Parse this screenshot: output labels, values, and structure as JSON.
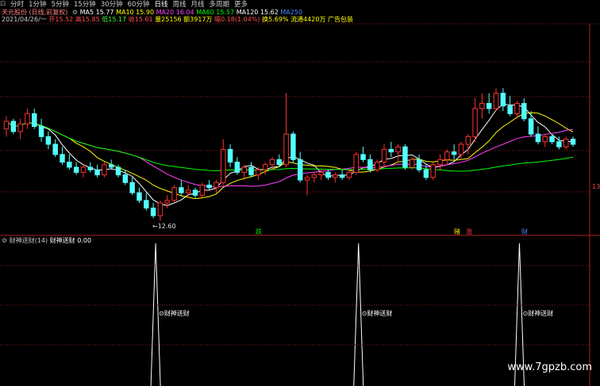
{
  "toolbar": {
    "items": [
      "分时",
      "1分钟",
      "5分钟",
      "15分钟",
      "30分钟",
      "60分钟",
      "日线",
      "周线",
      "月线",
      "多周期",
      "更多"
    ],
    "selected_index": 6,
    "leading_icon": "chart-frame-icon"
  },
  "info1": {
    "stock": "天元股份 (日线,前复权)",
    "ma5_label": "MA5",
    "ma5_value": "15.77",
    "ma10_label": "MA10",
    "ma10_value": "15.90",
    "ma20_label": "MA20",
    "ma20_value": "16.04",
    "ma60_label": "MA60",
    "ma60_value": "15.57",
    "ma120_label": "MA120",
    "ma120_value": "15.62",
    "ma250_label": "MA250",
    "value_color_ma5": "#ffffff",
    "value_color_ma10": "#ffff00",
    "value_color_ma20": "#ff44ff",
    "value_color_ma60": "#00ff00",
    "value_color_ma120": "#ffffff",
    "value_color_ma250": "#4488ff"
  },
  "info2": {
    "date": "2021/04/26/一",
    "open": "开15.52",
    "high": "高15.85",
    "low": "低15.17",
    "close": "收15.61",
    "vol": "量25156",
    "amount": "额3917万",
    "change": "幅0.18(1.04%)",
    "turnover": "换5.69%",
    "float": "流通4420万",
    "tags": "广告包装"
  },
  "price_label": "←12.60",
  "signal_labels": [
    "跌",
    "赌",
    "涨",
    "财"
  ],
  "indicator": {
    "title": "财神送财(14)",
    "name": "财神送财",
    "value": "0.00",
    "peak_label": "财神送财"
  },
  "right_axis_label": "13",
  "watermark": "www.7gpzb.com",
  "chart_data": {
    "type": "candlestick",
    "title": "天元股份 (日线,前复权)",
    "candles_ohlc": [
      [
        16.2,
        16.7,
        15.9,
        16.5
      ],
      [
        16.5,
        16.6,
        16.0,
        16.1
      ],
      [
        16.1,
        16.6,
        15.8,
        16.4
      ],
      [
        16.4,
        17.0,
        16.2,
        16.8
      ],
      [
        16.8,
        17.0,
        16.2,
        16.3
      ],
      [
        16.3,
        16.6,
        15.7,
        15.9
      ],
      [
        15.9,
        16.1,
        15.4,
        15.6
      ],
      [
        15.6,
        15.8,
        15.1,
        15.2
      ],
      [
        15.2,
        15.5,
        14.8,
        14.9
      ],
      [
        14.9,
        15.2,
        14.6,
        14.7
      ],
      [
        14.7,
        14.9,
        14.4,
        14.5
      ],
      [
        14.5,
        14.8,
        14.3,
        14.7
      ],
      [
        14.7,
        14.9,
        14.5,
        14.6
      ],
      [
        14.6,
        14.8,
        14.3,
        14.4
      ],
      [
        14.4,
        14.9,
        14.3,
        14.8
      ],
      [
        14.8,
        15.0,
        14.6,
        14.7
      ],
      [
        14.7,
        14.8,
        14.3,
        14.4
      ],
      [
        14.4,
        14.6,
        14.0,
        14.1
      ],
      [
        14.1,
        14.3,
        13.6,
        13.7
      ],
      [
        13.7,
        13.9,
        13.3,
        13.4
      ],
      [
        13.4,
        13.7,
        13.0,
        13.1
      ],
      [
        13.1,
        13.3,
        12.7,
        12.8
      ],
      [
        12.8,
        13.4,
        12.6,
        13.3
      ],
      [
        13.3,
        13.6,
        13.1,
        13.4
      ],
      [
        13.4,
        14.0,
        13.3,
        13.9
      ],
      [
        13.9,
        14.2,
        13.6,
        13.7
      ],
      [
        13.7,
        14.0,
        13.5,
        13.8
      ],
      [
        13.8,
        13.9,
        13.5,
        13.6
      ],
      [
        13.6,
        14.1,
        13.5,
        14.0
      ],
      [
        14.0,
        14.2,
        13.8,
        13.9
      ],
      [
        13.9,
        14.2,
        13.7,
        14.1
      ],
      [
        14.1,
        15.8,
        14.0,
        15.4
      ],
      [
        15.4,
        15.6,
        14.7,
        14.9
      ],
      [
        14.9,
        15.1,
        14.4,
        14.5
      ],
      [
        14.5,
        14.8,
        14.2,
        14.7
      ],
      [
        14.7,
        14.9,
        14.3,
        14.4
      ],
      [
        14.4,
        14.7,
        14.2,
        14.6
      ],
      [
        14.6,
        14.9,
        14.4,
        14.8
      ],
      [
        14.8,
        15.1,
        14.6,
        15.0
      ],
      [
        15.0,
        15.2,
        14.7,
        14.8
      ],
      [
        14.8,
        17.6,
        14.7,
        16.0
      ],
      [
        16.0,
        16.1,
        14.9,
        15.0
      ],
      [
        15.0,
        15.3,
        14.1,
        14.2
      ],
      [
        14.2,
        14.4,
        13.6,
        14.3
      ],
      [
        14.3,
        14.5,
        14.1,
        14.4
      ],
      [
        14.4,
        14.6,
        14.2,
        14.5
      ],
      [
        14.5,
        14.6,
        14.2,
        14.3
      ],
      [
        14.3,
        14.5,
        14.1,
        14.4
      ],
      [
        14.4,
        14.6,
        14.2,
        14.3
      ],
      [
        14.3,
        14.6,
        14.2,
        14.5
      ],
      [
        14.5,
        15.3,
        14.4,
        15.2
      ],
      [
        15.2,
        15.5,
        14.9,
        15.0
      ],
      [
        15.0,
        15.2,
        14.5,
        14.6
      ],
      [
        14.6,
        15.0,
        14.5,
        14.9
      ],
      [
        14.9,
        15.6,
        14.7,
        15.4
      ],
      [
        15.4,
        15.7,
        15.1,
        15.3
      ],
      [
        15.3,
        15.6,
        14.9,
        15.5
      ],
      [
        15.5,
        15.6,
        14.6,
        14.7
      ],
      [
        14.7,
        15.1,
        14.6,
        15.0
      ],
      [
        15.0,
        15.2,
        14.5,
        14.6
      ],
      [
        14.6,
        14.8,
        14.2,
        14.3
      ],
      [
        14.3,
        14.9,
        14.2,
        14.8
      ],
      [
        14.8,
        15.2,
        14.6,
        15.0
      ],
      [
        15.0,
        15.4,
        14.8,
        15.3
      ],
      [
        15.3,
        15.6,
        15.0,
        15.2
      ],
      [
        15.2,
        15.7,
        15.0,
        15.6
      ],
      [
        15.6,
        16.0,
        15.2,
        15.9
      ],
      [
        15.9,
        17.4,
        15.7,
        17.0
      ],
      [
        17.0,
        17.6,
        16.6,
        17.2
      ],
      [
        17.2,
        17.6,
        16.8,
        17.0
      ],
      [
        17.0,
        17.8,
        16.9,
        17.6
      ],
      [
        17.6,
        17.8,
        16.9,
        17.1
      ],
      [
        17.1,
        17.5,
        16.7,
        16.8
      ],
      [
        16.8,
        17.3,
        16.6,
        17.2
      ],
      [
        17.2,
        17.4,
        16.5,
        16.6
      ],
      [
        16.6,
        16.9,
        15.9,
        16.0
      ],
      [
        16.0,
        16.3,
        15.6,
        15.7
      ],
      [
        15.7,
        16.0,
        15.5,
        15.9
      ],
      [
        15.9,
        16.0,
        15.6,
        15.7
      ],
      [
        15.7,
        15.9,
        15.4,
        15.5
      ],
      [
        15.5,
        15.9,
        15.4,
        15.8
      ],
      [
        15.8,
        15.9,
        15.5,
        15.6
      ]
    ],
    "candle_colors": {
      "up": "#ff3030",
      "down": "#54ffff"
    },
    "moving_averages": [
      {
        "name": "MA5",
        "color": "#ffffff"
      },
      {
        "name": "MA10",
        "color": "#ffff00"
      },
      {
        "name": "MA20",
        "color": "#ff44ff"
      },
      {
        "name": "MA60",
        "color": "#00ff00"
      }
    ],
    "ylim": [
      12.4,
      17.9
    ],
    "indicator_spikes": [
      {
        "index": 21
      },
      {
        "index": 50
      },
      {
        "index": 73
      }
    ],
    "indicator_ylim": [
      0,
      1
    ]
  }
}
